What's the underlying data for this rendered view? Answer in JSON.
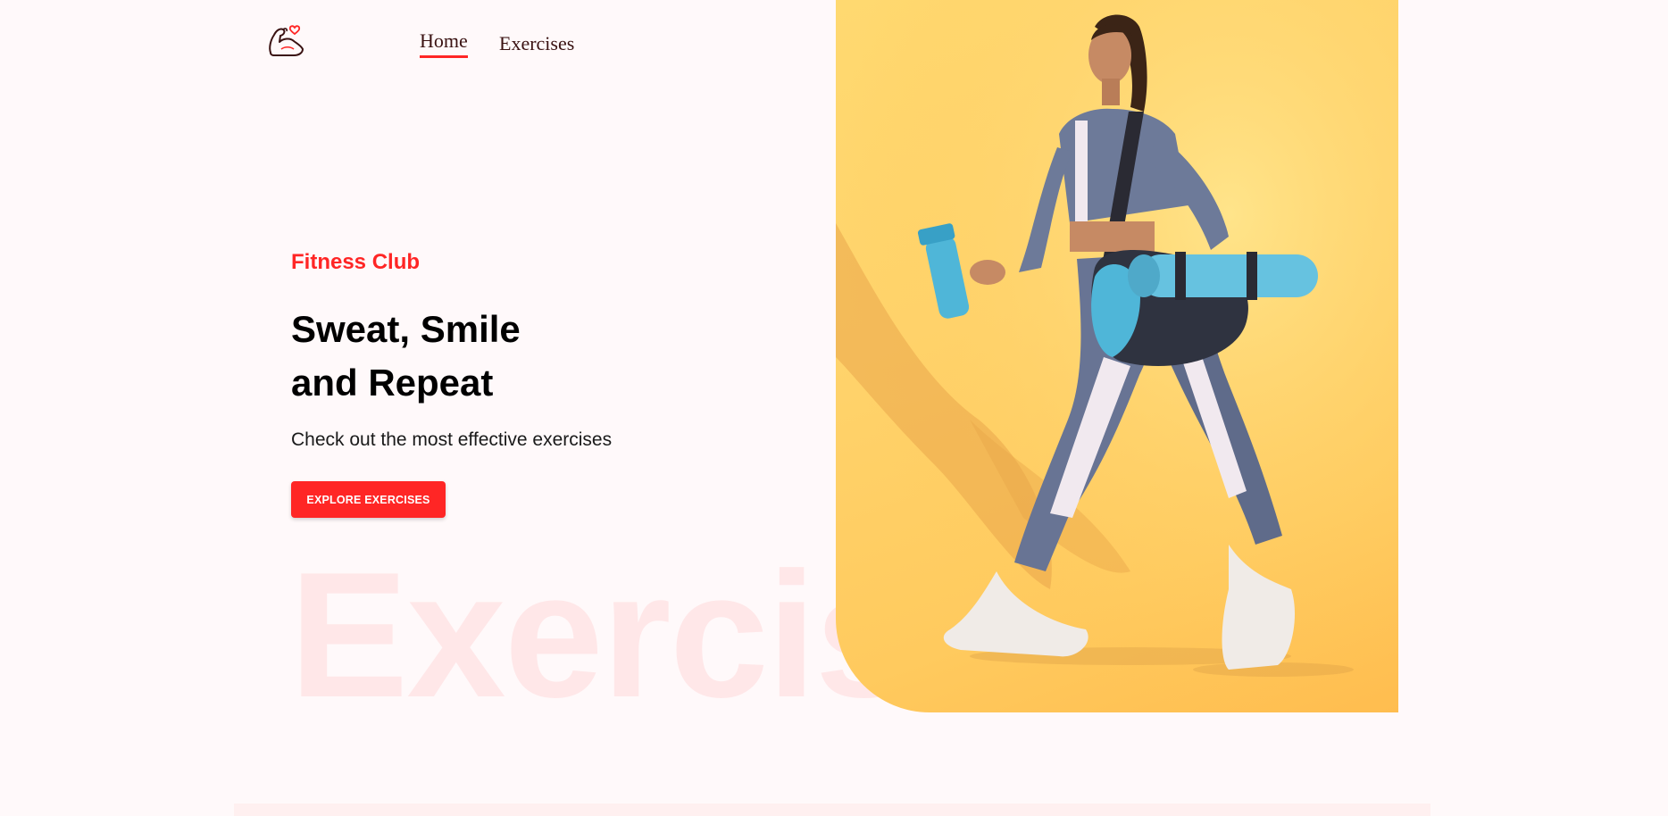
{
  "nav": {
    "logo_icon": "flexed-arm-heart-icon",
    "links": [
      {
        "label": "Home",
        "active": true
      },
      {
        "label": "Exercises",
        "active": false
      }
    ]
  },
  "hero": {
    "eyebrow": "Fitness Club",
    "headline_line1": "Sweat, Smile",
    "headline_line2": "and Repeat",
    "subtitle": "Check out the most effective exercises",
    "cta_label": "EXPLORE EXERCISES",
    "watermark": "Exercises",
    "image_icon": "woman-walking-with-gym-bag-photo"
  },
  "colors": {
    "accent": "#ff2625",
    "background": "#fff9fa",
    "image_bg": "#ffd36b"
  }
}
